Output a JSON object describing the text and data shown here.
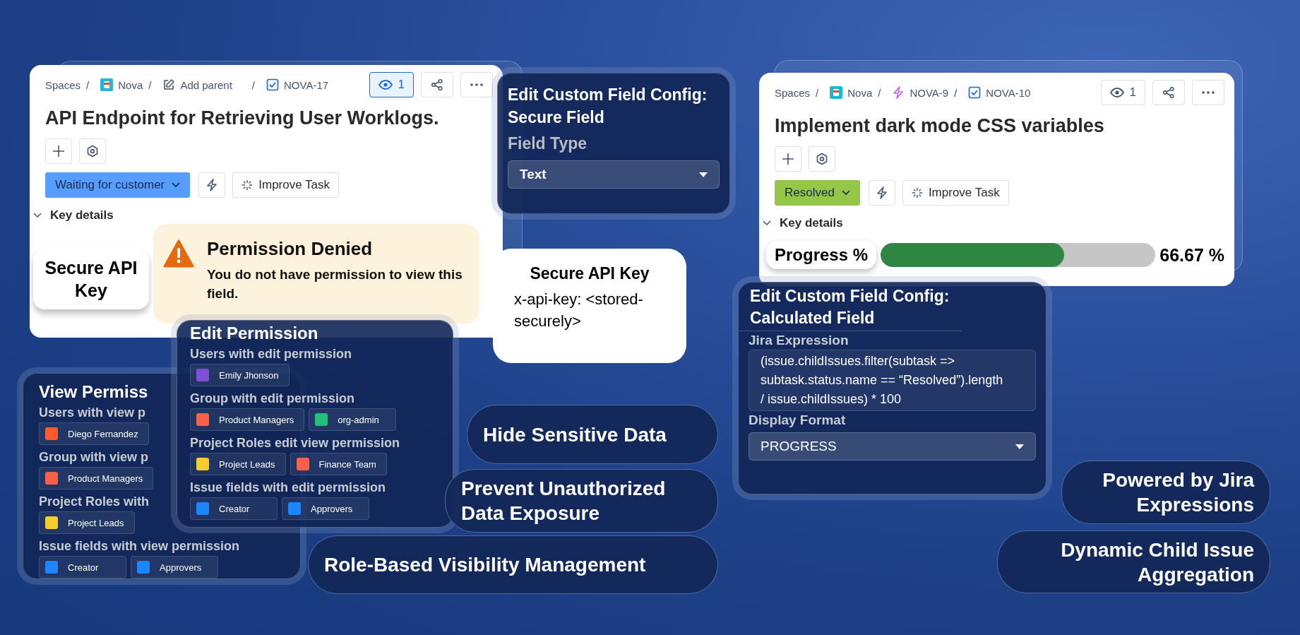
{
  "issue_cards": [
    {
      "breadcrumbs": [
        {
          "kind": "text",
          "text": "Spaces",
          "separator": "/"
        },
        {
          "kind": "space",
          "text": "Nova",
          "separator": "/"
        },
        {
          "kind": "edit",
          "text": "Add parent",
          "separator": "/"
        },
        {
          "kind": "task",
          "text": "NOVA-17"
        }
      ],
      "watch": {
        "count": "1",
        "selected": true
      },
      "title": "API Endpoint for Retrieving User Worklogs.",
      "status": {
        "label": "Waiting for customer",
        "color": "#579dff"
      },
      "improve_button": "Improve Task",
      "key_details": {
        "label": "Key details",
        "expanded": true
      }
    },
    {
      "breadcrumbs": [
        {
          "kind": "text",
          "text": "Spaces",
          "separator": "/"
        },
        {
          "kind": "space",
          "text": "Nova",
          "separator": "/"
        },
        {
          "kind": "epic",
          "text": "NOVA-9",
          "separator": "/"
        },
        {
          "kind": "task",
          "text": "NOVA-10"
        }
      ],
      "watch": {
        "count": "1",
        "selected": false
      },
      "title": "Implement dark mode CSS variables",
      "status": {
        "label": "Resolved",
        "color": "#94c748"
      },
      "improve_button": "Improve Task",
      "key_details": {
        "label": "Key details",
        "expanded": true
      },
      "progress_field": {
        "label": "Progress %",
        "level": 0.6667,
        "reading": "66.67 %"
      }
    }
  ],
  "secure_field_label": "Secure API Key",
  "permission_notice": {
    "title": "Permission Denied",
    "message": "You do not have permission to view this field."
  },
  "secure_config": {
    "title": "Edit Custom Field Config: Secure Field",
    "field_label": "Field Type",
    "value": "Text"
  },
  "key_callout": {
    "title": "Secure API Key",
    "value": "x-api-key: <stored-securely>"
  },
  "edit_permission": {
    "title": "Edit Permission",
    "sections": [
      {
        "label": "Users with edit permission",
        "chips": [
          {
            "text": "Emily Jhonson",
            "color": "#7f4fd6"
          }
        ]
      },
      {
        "label": "Group with edit permission",
        "chips": [
          {
            "text": "Product Managers",
            "color": "#f8604a"
          },
          {
            "text": "org-admin",
            "color": "#22c07a"
          }
        ]
      },
      {
        "label": "Project Roles edit view permission",
        "chips": [
          {
            "text": "Project Leads",
            "color": "#f5cd2f"
          },
          {
            "text": "Finance Team",
            "color": "#f8604a"
          }
        ]
      },
      {
        "label": "Issue fields with edit permission",
        "chips": [
          {
            "text": "Creator",
            "color": "#1c86ff"
          },
          {
            "text": "Approvers",
            "color": "#1c86ff"
          }
        ]
      }
    ]
  },
  "view_permission": {
    "title": "View Permiss",
    "sections": [
      {
        "label": "Users with view p",
        "chips": [
          {
            "text": "Diego Fernandez",
            "color": "#ff5a2e"
          }
        ]
      },
      {
        "label": "Group with view p",
        "chips": [
          {
            "text": "Product Managers",
            "color": "#f8604a"
          }
        ]
      },
      {
        "label": "Project Roles with",
        "chips": [
          {
            "text": "Project Leads",
            "color": "#f5cd2f"
          }
        ]
      },
      {
        "label": "Issue fields with view permission",
        "chips": [
          {
            "text": "Creator",
            "color": "#1c86ff"
          },
          {
            "text": "Approvers",
            "color": "#1c86ff"
          }
        ]
      }
    ]
  },
  "feature_pills": [
    {
      "text": "Hide Sensitive Data"
    },
    {
      "text": "Prevent Unauthorized Data Exposure"
    },
    {
      "text": "Role-Based Visibility Management"
    },
    {
      "text": "Powered by Jira Expressions"
    },
    {
      "text": "Dynamic Child Issue Aggregation"
    }
  ],
  "calculated_config": {
    "title": "Edit Custom Field Config: Calculated Field",
    "expression_label": "Jira Expression",
    "expression": "(issue.childIssues.filter(subtask => subtask.status.name == “Resolved”).length / issue.childIssues) * 100",
    "format_label": "Display Format",
    "format": "PROGRESS"
  }
}
